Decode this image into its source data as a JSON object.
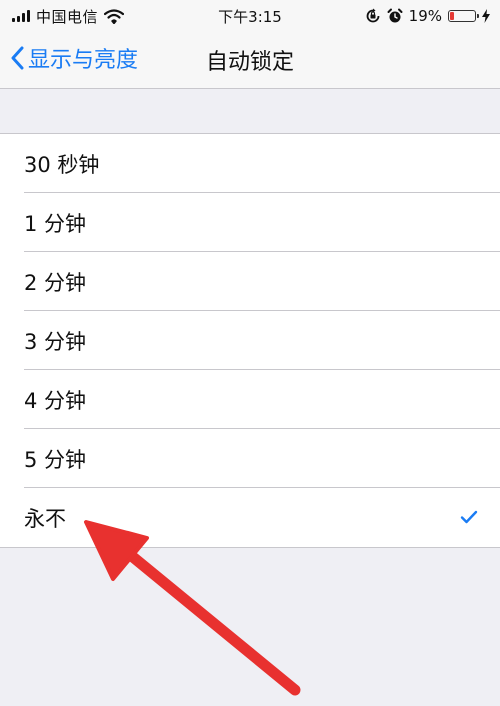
{
  "status_bar": {
    "carrier": "中国电信",
    "time": "下午3:15",
    "battery_percent": "19%",
    "battery_level": 0.19
  },
  "nav": {
    "back_label": "显示与亮度",
    "title": "自动锁定"
  },
  "options": [
    {
      "label": "30 秒钟",
      "selected": false
    },
    {
      "label": "1 分钟",
      "selected": false
    },
    {
      "label": "2 分钟",
      "selected": false
    },
    {
      "label": "3 分钟",
      "selected": false
    },
    {
      "label": "4 分钟",
      "selected": false
    },
    {
      "label": "5 分钟",
      "selected": false
    },
    {
      "label": "永不",
      "selected": true
    }
  ],
  "colors": {
    "accent": "#1a7cf4",
    "annotation_arrow": "#e8312f",
    "battery_low": "#e53935"
  },
  "icons": [
    "signal-icon",
    "wifi-icon",
    "orientation-lock-icon",
    "alarm-icon",
    "battery-icon",
    "charging-bolt-icon",
    "back-chevron-icon",
    "checkmark-icon"
  ]
}
